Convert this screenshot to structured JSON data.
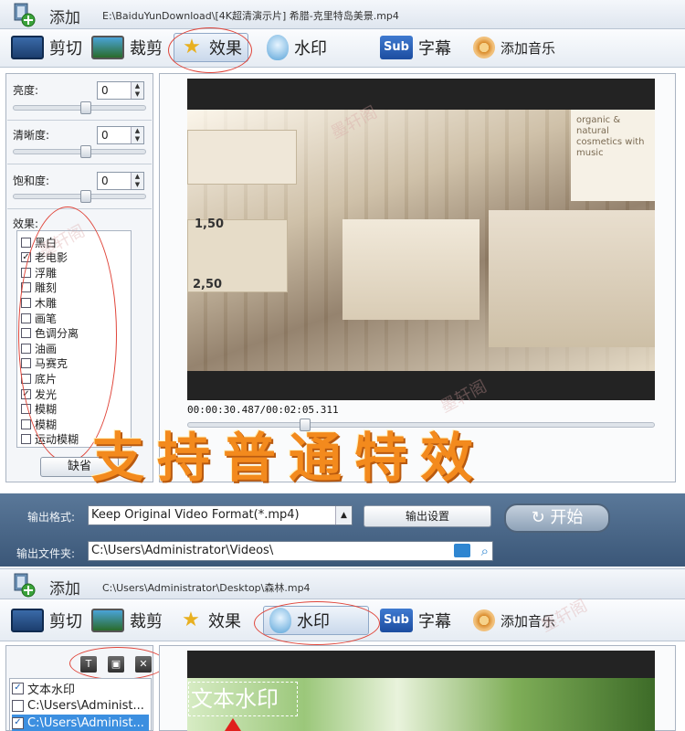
{
  "top": {
    "add_label": "添加",
    "file_path": "E:\\BaiduYunDownload\\[4K超清演示片] 希腊-克里特岛美景.mp4"
  },
  "tabs": [
    {
      "label": "剪切",
      "icon": "film-icon"
    },
    {
      "label": "裁剪",
      "icon": "crop-icon"
    },
    {
      "label": "效果",
      "icon": "star-icon",
      "active": true
    },
    {
      "label": "水印",
      "icon": "water-drop-icon"
    },
    {
      "label": "字幕",
      "icon": "subtitle-icon"
    },
    {
      "label": "添加音乐",
      "icon": "music-disc-icon"
    }
  ],
  "adjustments": {
    "brightness": {
      "label": "亮度:",
      "value": "0",
      "slider_fraction": 0.55
    },
    "sharpness": {
      "label": "清晰度:",
      "value": "0",
      "slider_fraction": 0.55
    },
    "saturation": {
      "label": "饱和度:",
      "value": "0",
      "slider_fraction": 0.55
    }
  },
  "effects": {
    "label": "效果:",
    "items": [
      {
        "label": "黑白",
        "checked": false
      },
      {
        "label": "老电影",
        "checked": true
      },
      {
        "label": "浮雕",
        "checked": false
      },
      {
        "label": "雕刻",
        "checked": false
      },
      {
        "label": "木雕",
        "checked": false
      },
      {
        "label": "画笔",
        "checked": false
      },
      {
        "label": "色调分离",
        "checked": false
      },
      {
        "label": "油画",
        "checked": false
      },
      {
        "label": "马赛克",
        "checked": false
      },
      {
        "label": "底片",
        "checked": false
      },
      {
        "label": "发光",
        "checked": true
      },
      {
        "label": "模糊",
        "checked": false
      },
      {
        "label": "模糊",
        "checked": false
      },
      {
        "label": "运动模糊",
        "checked": false
      }
    ],
    "default_button": "缺省"
  },
  "preview": {
    "timecode": "00:00:30.487/00:02:05.311",
    "seek_fraction": 0.244,
    "shelf_text": "organic & natural cosmetics with music",
    "price_tag_1": "1,50",
    "price_tag_2": "2,50"
  },
  "promo_text": "支持普通特效",
  "output": {
    "format_label": "输出格式:",
    "format_value": "Keep Original Video Format(*.mp4)",
    "settings_button": "输出设置",
    "folder_label": "输出文件夹:",
    "folder_value": "C:\\Users\\Administrator\\Videos\\",
    "start_button": "开始"
  },
  "second": {
    "add_label": "添加",
    "file_path": "C:\\Users\\Administrator\\Desktop\\森林.mp4",
    "active_tab": "水印",
    "watermarks": [
      {
        "label": "文本水印",
        "checked": true
      },
      {
        "label": "C:\\Users\\Administ...",
        "checked": false
      },
      {
        "label": "C:\\Users\\Administ...",
        "checked": true,
        "selected": true
      }
    ],
    "watermark_preview_text": "文本水印"
  },
  "site_watermark": "墨轩阁",
  "colors": {
    "accent_orange": "#f38a1d",
    "highlight_red": "#e0453a",
    "output_bar": "#4a6788"
  }
}
